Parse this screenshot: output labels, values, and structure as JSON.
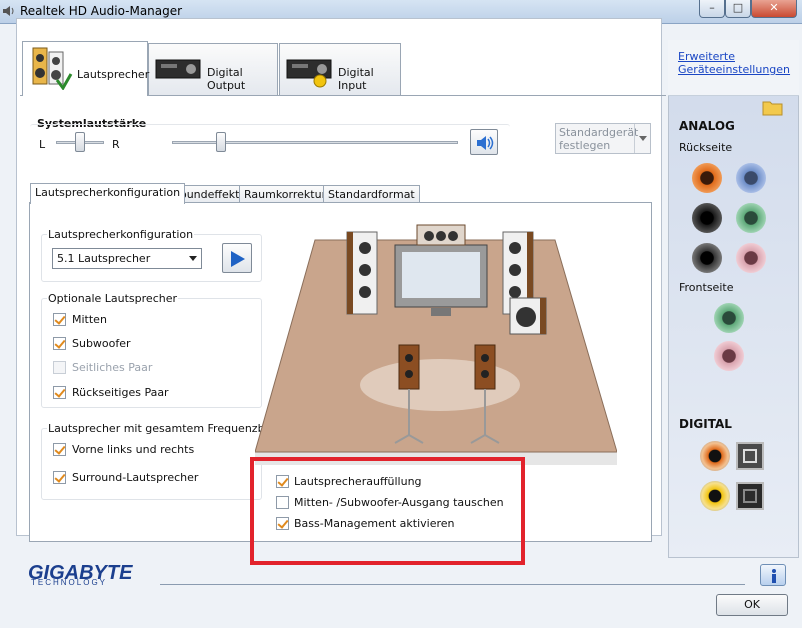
{
  "window": {
    "title": "Realtek HD Audio-Manager",
    "btn_min": "–",
    "btn_max": "□",
    "btn_close": "✕"
  },
  "top_tabs": [
    {
      "label": "Lautsprecher",
      "icon": "speaker-icon"
    },
    {
      "label": "Digital Output",
      "icon": "receiver-icon"
    },
    {
      "label": "Digital Input",
      "icon": "receiver-input-icon"
    }
  ],
  "volume": {
    "label": "Systemlautstärke",
    "left": "L",
    "right": "R",
    "balance_level": 0.5,
    "master_level": 0.17
  },
  "default_device": {
    "label": "Standardgerät festlegen"
  },
  "sub_tabs": [
    "Lautsprecherkonfiguration",
    "Soundeffekt",
    "Raumkorrektur",
    "Standardformat"
  ],
  "speaker_config": {
    "group_label": "Lautsprecherkonfiguration",
    "selected": "5.1 Lautsprecher"
  },
  "optional": {
    "group_label": "Optionale Lautsprecher",
    "items": [
      {
        "label": "Mitten",
        "checked": true,
        "enabled": true
      },
      {
        "label": "Subwoofer",
        "checked": true,
        "enabled": true
      },
      {
        "label": "Seitliches Paar",
        "checked": false,
        "enabled": false
      },
      {
        "label": "Rückseitiges Paar",
        "checked": true,
        "enabled": true
      }
    ]
  },
  "fullrange": {
    "group_label": "Lautsprecher mit gesamtem Frequenzbereich",
    "items": [
      {
        "label": "Vorne links und rechts",
        "checked": true
      },
      {
        "label": "Surround-Lautsprecher",
        "checked": true
      }
    ]
  },
  "extra_options": [
    {
      "label": "Lautsprecherauffüllung",
      "checked": true
    },
    {
      "label": "Mitten- /Subwoofer-Ausgang tauschen",
      "checked": false
    },
    {
      "label": "Bass-Management aktivieren",
      "checked": true
    }
  ],
  "right_panel": {
    "link": "Erweiterte Geräteeinstellungen",
    "analog": "ANALOG",
    "rear": "Rückseite",
    "front": "Frontseite",
    "digital": "DIGITAL",
    "colors": {
      "orange": "#e06a1a",
      "blue": "#6f8fc9",
      "black": "#1a1a1a",
      "green": "#5faa7a",
      "pink": "#d9a3ae",
      "yellow": "#f2c40f"
    }
  },
  "brand": {
    "name": "GIGABYTE",
    "sub": "TECHNOLOGY"
  },
  "ok_label": "OK",
  "colors": {
    "red_highlight": "#e2232c",
    "accent_orange": "#e08a1e"
  }
}
